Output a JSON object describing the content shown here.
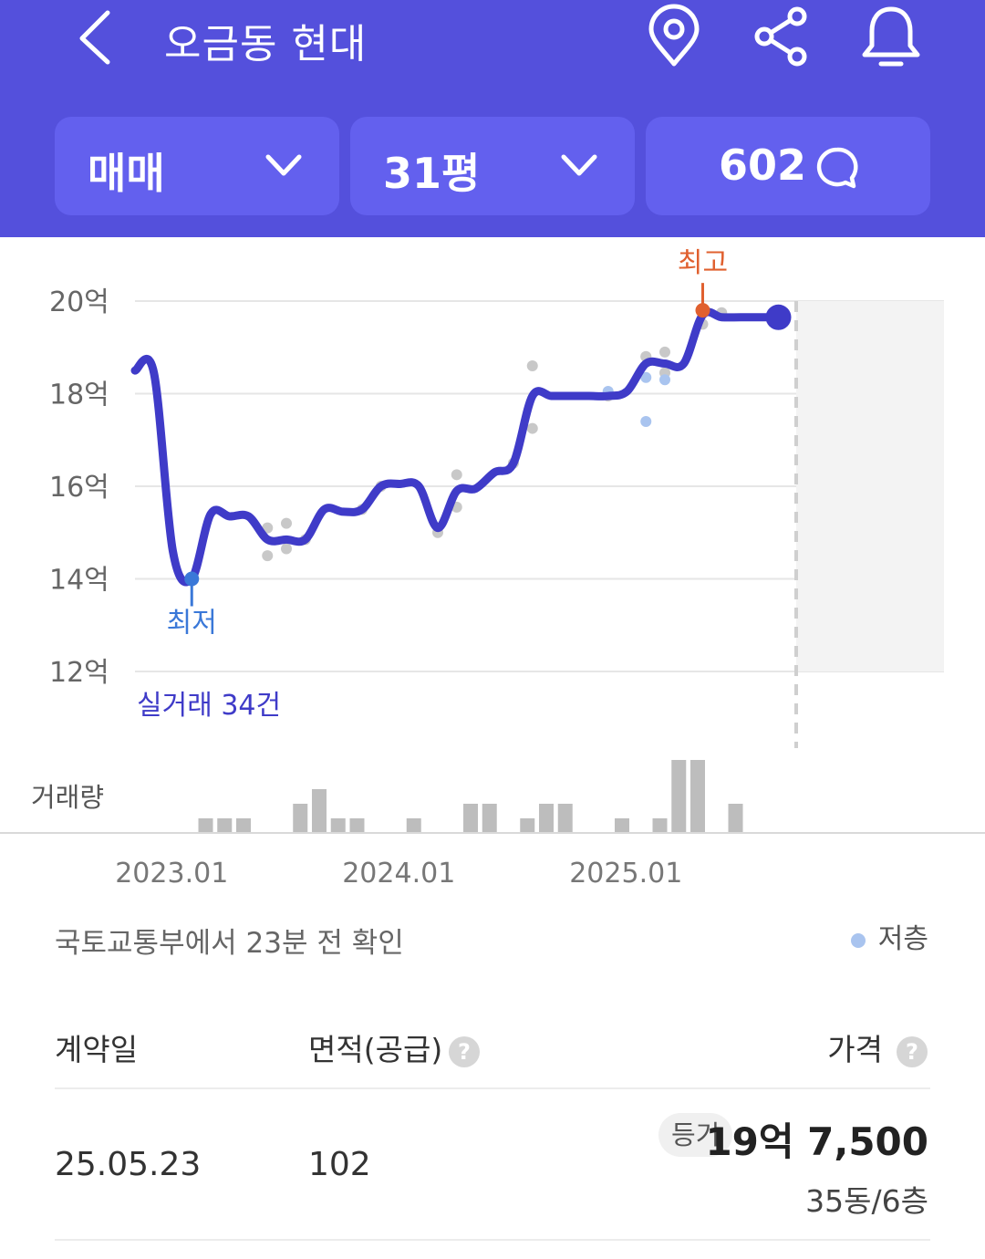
{
  "header": {
    "title": "오금동 현대",
    "icons": [
      "back-icon",
      "location-pin-icon",
      "share-icon",
      "bell-icon"
    ]
  },
  "filters": {
    "deal_type": "매매",
    "size": "31평",
    "comment_count": "602"
  },
  "colors": {
    "header_bg": "#5450dc",
    "pill_bg": "#6360ee",
    "trend_line": "#3f3bc8",
    "low_marker": "#3a78d8",
    "high_marker": "#e0602f",
    "low_floor_dot": "#a9c4ef",
    "trade_dot": "#c8c8c8",
    "volume_bar": "#bdbdbd"
  },
  "chart_data": {
    "type": "line",
    "y_unit": "억",
    "ylim": [
      12,
      20
    ],
    "y_ticks": [
      "20억",
      "18억",
      "16억",
      "14억",
      "12억"
    ],
    "x_tick_labels": [
      "2023.01",
      "2024.01",
      "2025.01"
    ],
    "series": [
      {
        "x": [
          "2022-10",
          "2022-11",
          "2022-12",
          "2023-01",
          "2023-02",
          "2023-03",
          "2023-04",
          "2023-05",
          "2023-06",
          "2023-07",
          "2023-08",
          "2023-09",
          "2023-10",
          "2023-11",
          "2023-12",
          "2024-01",
          "2024-02",
          "2024-03",
          "2024-04",
          "2024-05",
          "2024-06",
          "2024-07",
          "2024-08",
          "2024-09",
          "2024-10",
          "2024-11",
          "2024-12",
          "2025-01",
          "2025-02",
          "2025-03",
          "2025-04",
          "2025-05",
          "2025-06",
          "2025-07",
          "2025-08"
        ],
        "y": [
          18.5,
          18.45,
          14.6,
          14.0,
          15.4,
          15.35,
          15.35,
          14.85,
          14.85,
          14.85,
          15.5,
          15.45,
          15.5,
          16.0,
          16.05,
          16.0,
          15.1,
          15.9,
          15.95,
          16.3,
          16.5,
          17.95,
          17.95,
          17.95,
          17.95,
          17.95,
          18.05,
          18.65,
          18.65,
          18.65,
          19.7,
          19.65,
          19.65,
          19.65,
          19.65
        ]
      }
    ],
    "trades": [
      {
        "x": "2023-05",
        "y": 15.1
      },
      {
        "x": "2023-05",
        "y": 14.5
      },
      {
        "x": "2023-06",
        "y": 15.2
      },
      {
        "x": "2023-06",
        "y": 14.65
      },
      {
        "x": "2023-07",
        "y": 14.85
      },
      {
        "x": "2023-10",
        "y": 15.5
      },
      {
        "x": "2023-11",
        "y": 16.0
      },
      {
        "x": "2024-02",
        "y": 15.0
      },
      {
        "x": "2024-03",
        "y": 16.25
      },
      {
        "x": "2024-03",
        "y": 15.55
      },
      {
        "x": "2024-06",
        "y": 16.5
      },
      {
        "x": "2024-07",
        "y": 18.6
      },
      {
        "x": "2024-07",
        "y": 17.25
      },
      {
        "x": "2024-11",
        "y": 17.95
      },
      {
        "x": "2025-01",
        "y": 18.8
      },
      {
        "x": "2025-01",
        "y": 18.8
      },
      {
        "x": "2025-02",
        "y": 18.9
      },
      {
        "x": "2025-02",
        "y": 18.45
      },
      {
        "x": "2025-04",
        "y": 19.5
      },
      {
        "x": "2025-05",
        "y": 19.75
      }
    ],
    "low_floor_trades": [
      {
        "x": "2024-11",
        "y": 18.05
      },
      {
        "x": "2025-01",
        "y": 18.35
      },
      {
        "x": "2025-01",
        "y": 17.4
      },
      {
        "x": "2025-02",
        "y": 18.3
      }
    ],
    "low": {
      "x": "2023-01",
      "y": 14.0,
      "label": "최저"
    },
    "high": {
      "x": "2025-04",
      "y": 19.8,
      "label": "최고"
    },
    "current": {
      "x": "2025-08",
      "y": 19.65
    },
    "trade_count_label": "실거래 34건",
    "volume_label": "거래량",
    "volume": {
      "x": [
        "2022-12",
        "2023-01",
        "2023-02",
        "2023-05",
        "2023-06",
        "2023-07",
        "2023-08",
        "2023-11",
        "2024-02",
        "2024-03",
        "2024-05",
        "2024-06",
        "2024-07",
        "2024-10",
        "2024-12",
        "2025-01",
        "2025-02",
        "2025-04"
      ],
      "counts": [
        1,
        1,
        1,
        2,
        3,
        1,
        1,
        1,
        2,
        2,
        1,
        2,
        2,
        1,
        1,
        5,
        5,
        2
      ]
    }
  },
  "source": "국토교통부에서 23분 전 확인",
  "legend": {
    "low_floor": "저층"
  },
  "table": {
    "headers": {
      "date": "계약일",
      "area": "면적(공급)",
      "price": "가격"
    },
    "rows": [
      {
        "date": "25.05.23",
        "area": "102",
        "badge": "등기",
        "price": "19억 7,500",
        "unit": "35동/6층"
      }
    ]
  }
}
